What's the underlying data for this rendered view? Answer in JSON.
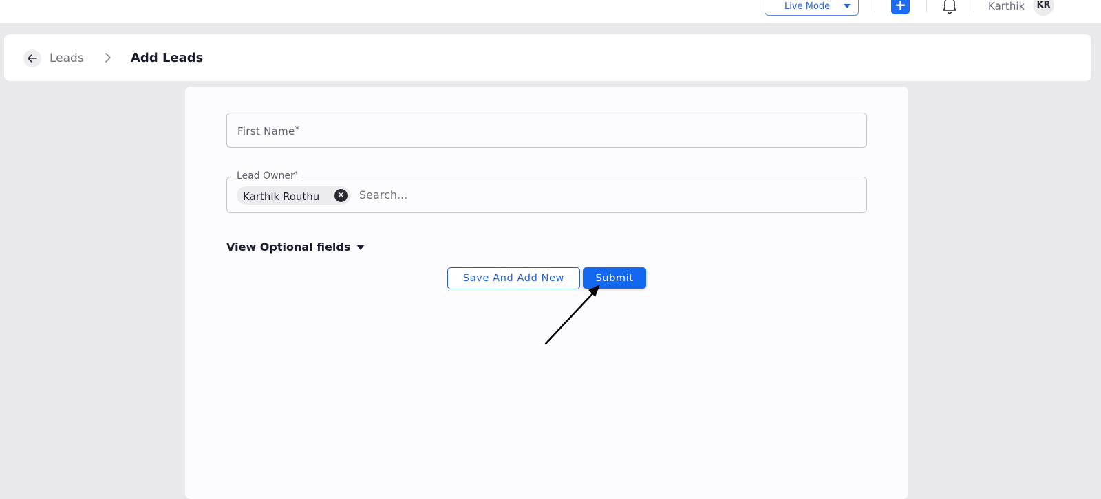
{
  "topbar": {
    "mode": "Live Mode",
    "add_symbol": "+",
    "user_name": "Karthik",
    "avatar_initials": "KR",
    "accent_color": "#1d6cf2"
  },
  "breadcrumb": {
    "parent": "Leads",
    "current": "Add Leads"
  },
  "form": {
    "first_name_label": "First Name",
    "required_marker": "*",
    "lead_owner_label": "Lead Owner",
    "lead_owner_chip": "Karthik Routhu",
    "chip_remove_symbol": "✕",
    "search_placeholder": "Search...",
    "optional_toggle": "View Optional fields",
    "save_and_add_new": "Save And Add New",
    "submit": "Submit"
  },
  "icons": {
    "back": "arrow-left-icon",
    "chevron": "chevron-right-icon",
    "bell": "bell-icon",
    "caret": "caret-down-icon",
    "annotation": "arrow-pointer-annotation"
  }
}
